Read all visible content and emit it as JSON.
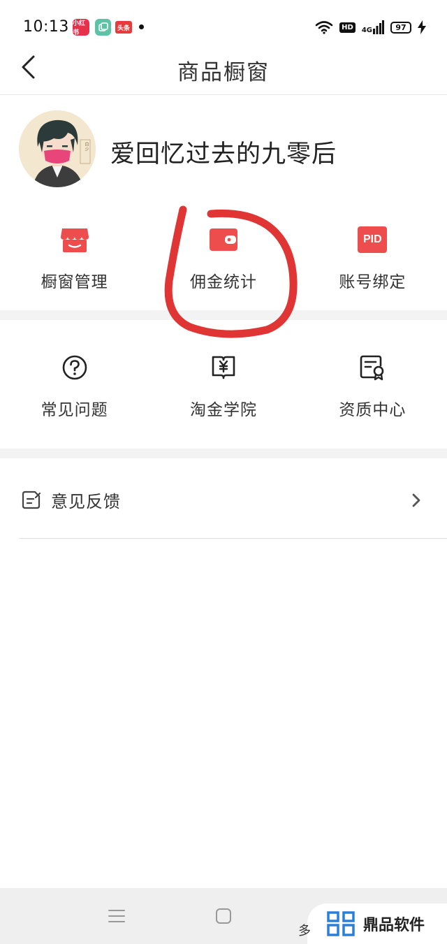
{
  "status_bar": {
    "time": "10:13",
    "badges": [
      "小红书",
      "",
      "头条"
    ],
    "hd": "HD",
    "network": "4G",
    "battery": "97"
  },
  "nav": {
    "title": "商品橱窗"
  },
  "profile": {
    "username": "爱回忆过去的九零后",
    "avatar_text": "白 少"
  },
  "grid_row_1": [
    {
      "label": "橱窗管理",
      "icon": "store-icon"
    },
    {
      "label": "佣金统计",
      "icon": "wallet-icon"
    },
    {
      "label": "账号绑定",
      "icon": "pid-icon",
      "icon_text": "PID"
    }
  ],
  "grid_row_2": [
    {
      "label": "常见问题",
      "icon": "question-circle-icon"
    },
    {
      "label": "淘金学院",
      "icon": "yuan-book-icon"
    },
    {
      "label": "资质中心",
      "icon": "certificate-icon"
    }
  ],
  "feedback": {
    "label": "意见反馈"
  },
  "watermark": {
    "text": "鼎品软件",
    "fragment": "多"
  },
  "colors": {
    "accent": "#ee4d4d",
    "annotation": "#e03535",
    "divider": "#f3f3f3"
  }
}
